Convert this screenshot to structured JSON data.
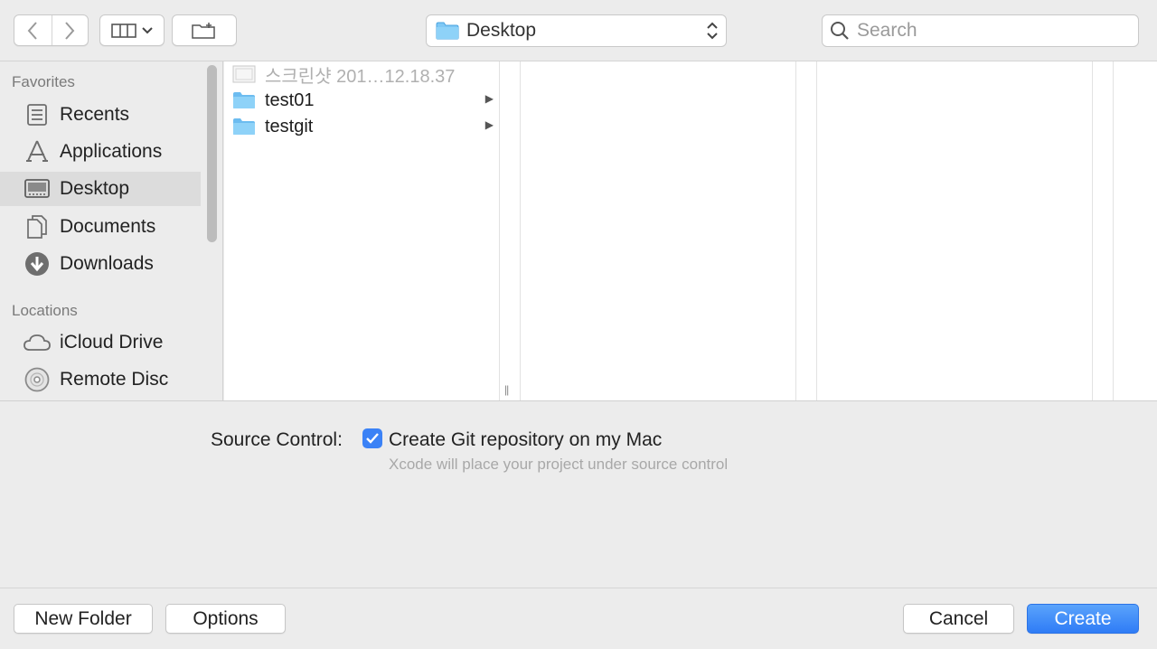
{
  "toolbar": {
    "path_label": "Desktop",
    "search_placeholder": "Search"
  },
  "sidebar": {
    "favorites_header": "Favorites",
    "favorites": [
      {
        "label": "Recents",
        "icon": "recents-icon"
      },
      {
        "label": "Applications",
        "icon": "applications-icon"
      },
      {
        "label": "Desktop",
        "icon": "desktop-icon",
        "selected": true
      },
      {
        "label": "Documents",
        "icon": "documents-icon"
      },
      {
        "label": "Downloads",
        "icon": "downloads-icon"
      }
    ],
    "locations_header": "Locations",
    "locations": [
      {
        "label": "iCloud Drive",
        "icon": "cloud-icon"
      },
      {
        "label": "Remote Disc",
        "icon": "disc-icon"
      }
    ]
  },
  "files": [
    {
      "name": "스크린샷 201…12.18.37",
      "kind": "screenshot",
      "enabled": false
    },
    {
      "name": "test01",
      "kind": "folder",
      "enabled": true
    },
    {
      "name": "testgit",
      "kind": "folder",
      "enabled": true
    }
  ],
  "source_control": {
    "label": "Source Control:",
    "checkbox_label": "Create Git repository on my Mac",
    "checked": true,
    "hint": "Xcode will place your project under source control"
  },
  "buttons": {
    "new_folder": "New Folder",
    "options": "Options",
    "cancel": "Cancel",
    "create": "Create"
  },
  "colors": {
    "accent": "#3b82f6",
    "folder": "#7ec8f5"
  }
}
